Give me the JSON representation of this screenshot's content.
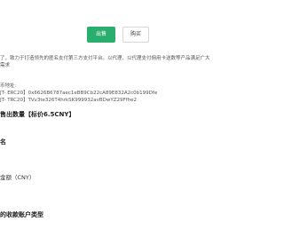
{
  "tabs": {
    "sell_label": "出售",
    "buy_label": "购买"
  },
  "description": {
    "line1": "了，致力于打造领先的匿名支付第三方支付平台。以代理、以代理支付佣用卡送数等产品满足广大",
    "line2": "需求"
  },
  "payment_address": {
    "label": "币地址:",
    "erc20": "JT- ERC20】0x6626B6787aec1eBB9Cb22cA89E832A2c0b199Dfe",
    "trc20": "JT- TRC20】TVv3te326T4hrkSK999932avBDwYZ29Ffhe2"
  },
  "form": {
    "quantity_heading": "售出数量【标价6.5CNY】",
    "name_heading": "名",
    "amount_heading": "金额（CNY）",
    "account_type_heading": "的收款账户类型"
  },
  "colors": {
    "accent": "#2aae6e"
  }
}
